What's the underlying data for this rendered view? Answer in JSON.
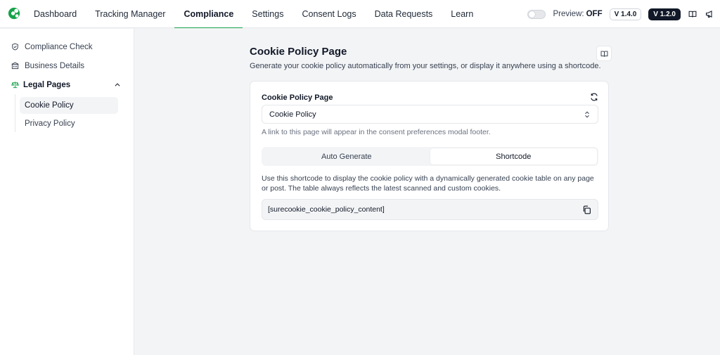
{
  "nav": {
    "items": [
      "Dashboard",
      "Tracking Manager",
      "Compliance",
      "Settings",
      "Consent Logs",
      "Data Requests",
      "Learn"
    ],
    "active": "Compliance"
  },
  "toolbar": {
    "preview_label": "Preview:",
    "preview_state": "OFF",
    "version_a": "V 1.4.0",
    "version_b": "V 1.2.0"
  },
  "sidebar": {
    "compliance_check": "Compliance Check",
    "business_details": "Business Details",
    "legal_pages": "Legal Pages",
    "sub_items": [
      "Cookie Policy",
      "Privacy Policy"
    ]
  },
  "page": {
    "title": "Cookie Policy Page",
    "description": "Generate your cookie policy automatically from your settings, or display it anywhere using a shortcode."
  },
  "card": {
    "field_label": "Cookie Policy Page",
    "selected_page": "Cookie Policy",
    "hint": "A link to this page will appear in the consent preferences modal footer.",
    "tabs": [
      "Auto Generate",
      "Shortcode"
    ],
    "active_tab": "Shortcode",
    "description": "Use this shortcode to display the cookie policy with a dynamically generated cookie table on any page or post. The table always reflects the latest scanned and custom cookies.",
    "shortcode": "[surecookie_cookie_policy_content]"
  },
  "colors": {
    "accent": "#16a34a",
    "dark_badge": "#111827"
  }
}
